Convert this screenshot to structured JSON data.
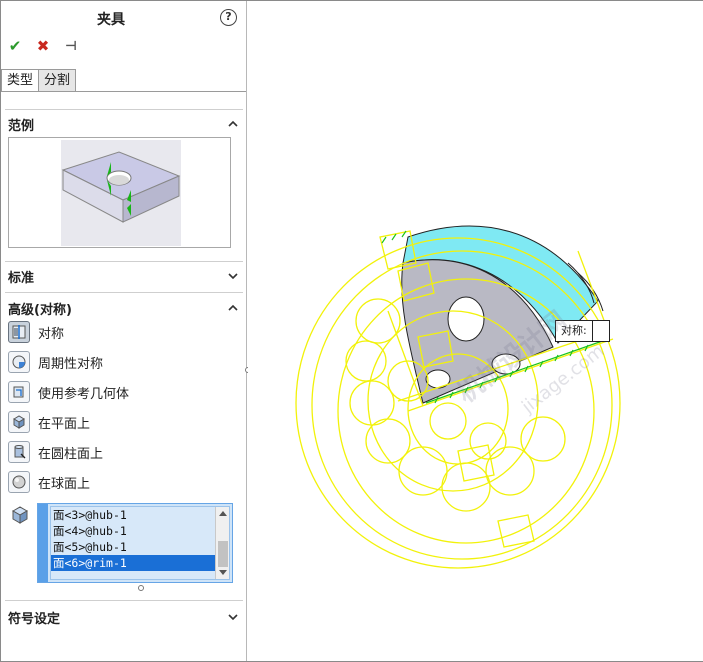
{
  "panel": {
    "title": "夹具",
    "help": "?",
    "actions": {
      "ok": "✔",
      "cancel": "✖",
      "pin": "⊣"
    },
    "tabs": [
      {
        "label": "类型",
        "active": true
      },
      {
        "label": "分割",
        "active": false
      }
    ],
    "sections": {
      "example": "范例",
      "standard": "标准",
      "advanced": "高级(对称)",
      "symbol": "符号设定"
    },
    "options": [
      {
        "label": "对称",
        "icon": "symmetry-icon",
        "active": true
      },
      {
        "label": "周期性对称",
        "icon": "cyclic-symmetry-icon",
        "active": false
      },
      {
        "label": "使用参考几何体",
        "icon": "reference-geometry-icon",
        "active": false
      },
      {
        "label": "在平面上",
        "icon": "flat-face-icon",
        "active": false
      },
      {
        "label": "在圆柱面上",
        "icon": "cylindrical-face-icon",
        "active": false
      },
      {
        "label": "在球面上",
        "icon": "spherical-face-icon",
        "active": false
      }
    ],
    "faces": [
      {
        "label": "面<3>@hub-1",
        "selected": false
      },
      {
        "label": "面<4>@hub-1",
        "selected": false
      },
      {
        "label": "面<5>@hub-1",
        "selected": false
      },
      {
        "label": "面<6>@rim-1",
        "selected": true
      }
    ]
  },
  "viewport": {
    "callout_label": "对称:",
    "watermark": "机械设计网",
    "watermark_url": "jixage.com"
  },
  "colors": {
    "accent": "#1a6fd6",
    "wire": "#f2f20a",
    "face_cyan": "#7fe9f3",
    "face_gray": "#b9b9c4"
  }
}
